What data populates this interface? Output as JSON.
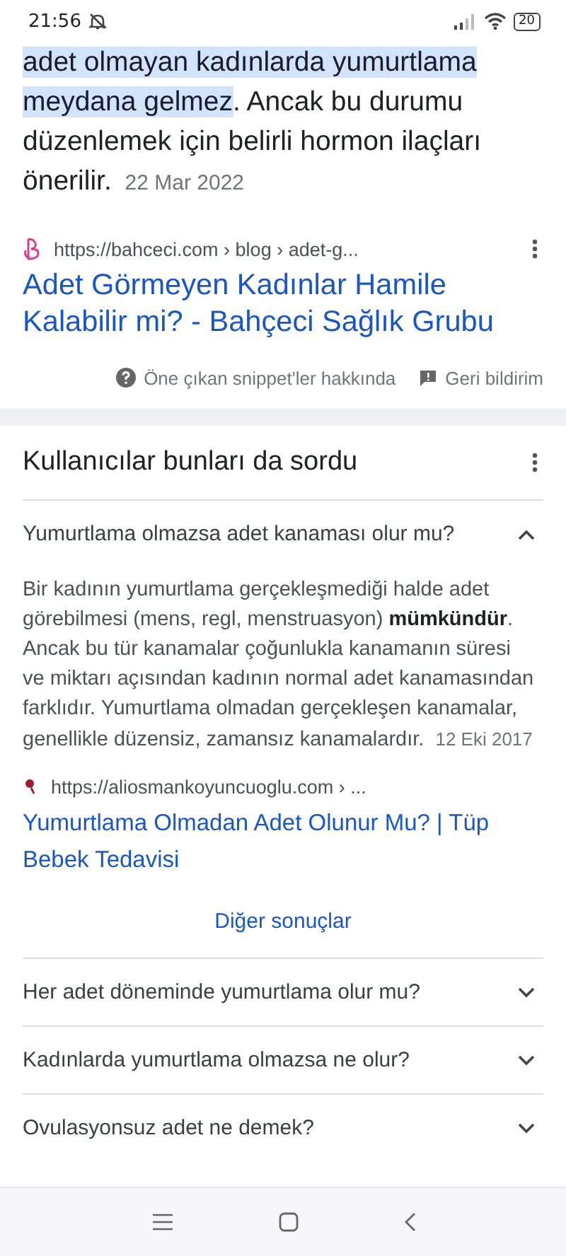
{
  "status_bar": {
    "time": "21:56",
    "battery": "20"
  },
  "snippet": {
    "highlight": "adet olmayan kadınlarda yumurtlama meydana gelmez",
    "text": ". Ancak bu durumu düzenlemek için belirli hormon ilaçları önerilir.",
    "date": "22 Mar 2022",
    "url": "https://bahceci.com › blog › adet-g...",
    "title": "Adet Görmeyen Kadınlar Hamile Kalabilir mi? - Bahçeci Sağlık Grubu",
    "about": "Öne çıkan snippet'ler hakkında",
    "feedback": "Geri bildirim"
  },
  "related": {
    "heading": "Kullanıcılar bunları da sordu",
    "more": "Diğer sonuçlar",
    "questions": [
      {
        "question": "Yumurtlama olmazsa adet kanaması olur mu?",
        "expanded": true,
        "answer": "Bir kadının yumurtlama gerçekleşmediği halde adet görebilmesi (mens, regl, menstruasyon) **mümkündür**. Ancak bu tür kanamalar çoğunlukla kanamanın süresi ve miktarı açısından kadının normal adet kanamasından farklıdır. Yumurtlama olmadan gerçekleşen kanamalar, genellikle düzensiz, zamansız kanamalardır.",
        "date": "12 Eki 2017",
        "url": "https://aliosmankoyuncuoglu.com › ...",
        "title": "Yumurtlama Olmadan Adet Olunur Mu? | Tüp Bebek Tedavisi"
      },
      {
        "question": "Her adet döneminde yumurtlama olur mu?",
        "expanded": false
      },
      {
        "question": "Kadınlarda yumurtlama olmazsa ne olur?",
        "expanded": false
      },
      {
        "question": "Ovulasyonsuz adet ne demek?",
        "expanded": false
      }
    ]
  }
}
